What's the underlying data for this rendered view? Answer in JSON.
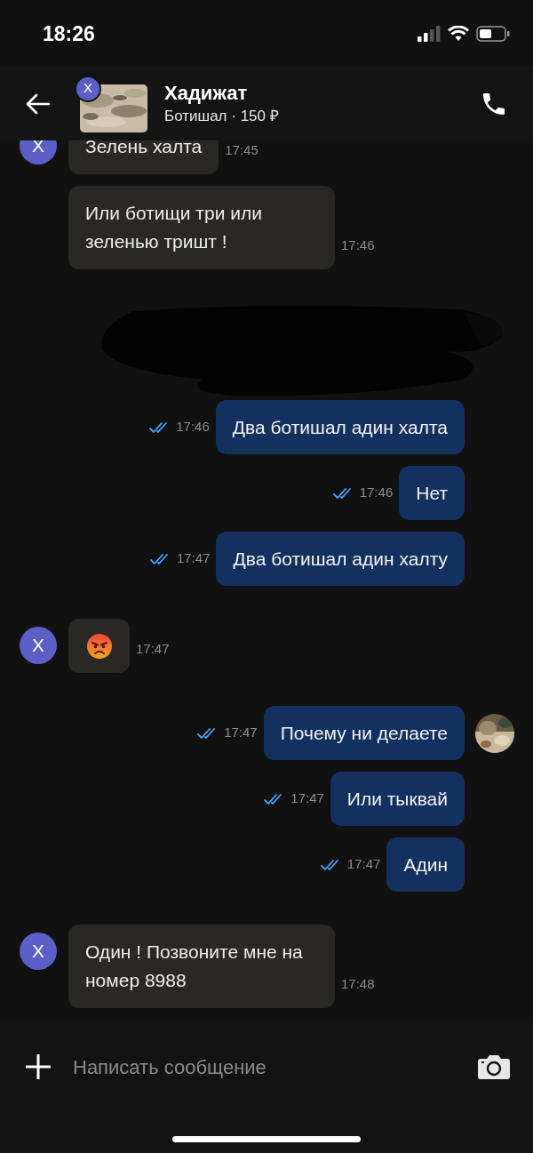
{
  "status_bar": {
    "time": "18:26"
  },
  "header": {
    "name": "Хадижат",
    "subtitle": "Ботишал · 150 ₽",
    "avatar_letter": "Х"
  },
  "messages": [
    {
      "outgoing": false,
      "kind": "text",
      "text": "Зелень халта",
      "time": "17:45",
      "avatar_letter": "Х"
    },
    {
      "outgoing": false,
      "kind": "text",
      "text": "Или ботищи три или зеленью тришт !",
      "time": "17:46"
    },
    {
      "kind": "redacted"
    },
    {
      "outgoing": true,
      "kind": "text",
      "text": "Два ботишал адин халта",
      "time": "17:46",
      "read": true
    },
    {
      "outgoing": true,
      "kind": "text",
      "text": "Нет",
      "time": "17:46",
      "read": true
    },
    {
      "outgoing": true,
      "kind": "text",
      "text": "Два ботишал адин халту",
      "time": "17:47",
      "read": true
    },
    {
      "outgoing": false,
      "kind": "emoji",
      "time": "17:47",
      "avatar_letter": "Х"
    },
    {
      "outgoing": true,
      "kind": "text",
      "text": "Почему ни делаете",
      "time": "17:47",
      "read": true,
      "avatar": true
    },
    {
      "outgoing": true,
      "kind": "text",
      "text": "Или тыквай",
      "time": "17:47",
      "read": true
    },
    {
      "outgoing": true,
      "kind": "text",
      "text": "Адин",
      "time": "17:47",
      "read": true
    },
    {
      "outgoing": false,
      "kind": "text",
      "text": "Один ! Позвоните мне на номер 8988",
      "time": "17:48",
      "avatar_letter": "Х"
    }
  ],
  "composer": {
    "placeholder": "Написать сообщение"
  }
}
